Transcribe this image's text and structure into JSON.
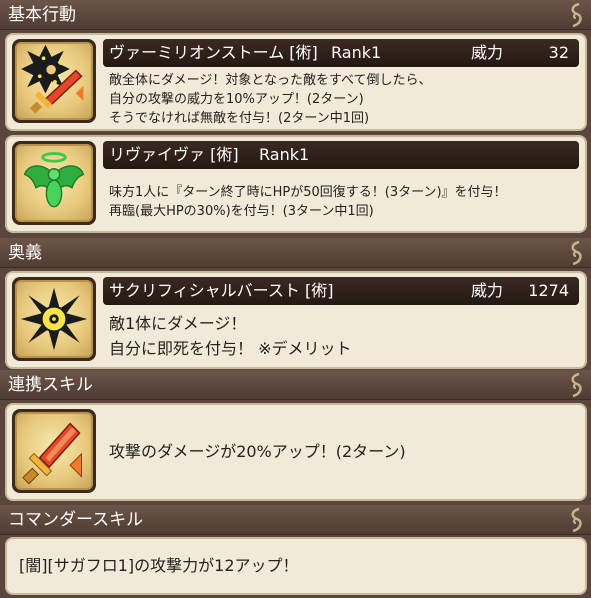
{
  "sections": {
    "basic": "基本行動",
    "ougi": "奥義",
    "renkei": "連携スキル",
    "commander": "コマンダースキル"
  },
  "skills": [
    {
      "name": "ヴァーミリオンストーム [術]",
      "rank": "Rank1",
      "power_label": "威力",
      "power_value": "32",
      "lines": [
        "敵全体にダメージ！対象となった敵をすべて倒したら、",
        "自分の攻撃の威力を10%アップ！(2ターン)",
        "そうでなければ無敵を付与！(2ターン中1回)"
      ]
    },
    {
      "name": "リヴァイヴァ [術]",
      "rank": "Rank1",
      "lines": [
        "味方1人に『ターン終了時にHPが50回復する！(3ターン)』を付与！",
        "再臨(最大HPの30%)を付与！(3ターン中1回)"
      ]
    },
    {
      "name": "サクリフィシャルバースト [術]",
      "power_label": "威力",
      "power_value": "1274",
      "lines": [
        "敵1体にダメージ！",
        "自分に即死を付与！ ※デメリット"
      ]
    },
    {
      "lines": [
        "攻撃のダメージが20%アップ！(2ターン)"
      ]
    },
    {
      "lines": [
        "[闇][サガフロ1]の攻撃力が12アップ！"
      ]
    }
  ],
  "icons": {
    "skill1": "shuriken-sword-icon",
    "skill2": "winged-angel-icon",
    "skill3": "burst-icon",
    "skill4": "sword-icon",
    "section": "swirl-ornament-icon"
  },
  "colors": {
    "header_bg": "#5a463c",
    "panel_bg": "#f1ead8",
    "title_bar": "#2a1d16",
    "icon_frame": "#3c2a1f",
    "gold": "#e7c97c"
  }
}
